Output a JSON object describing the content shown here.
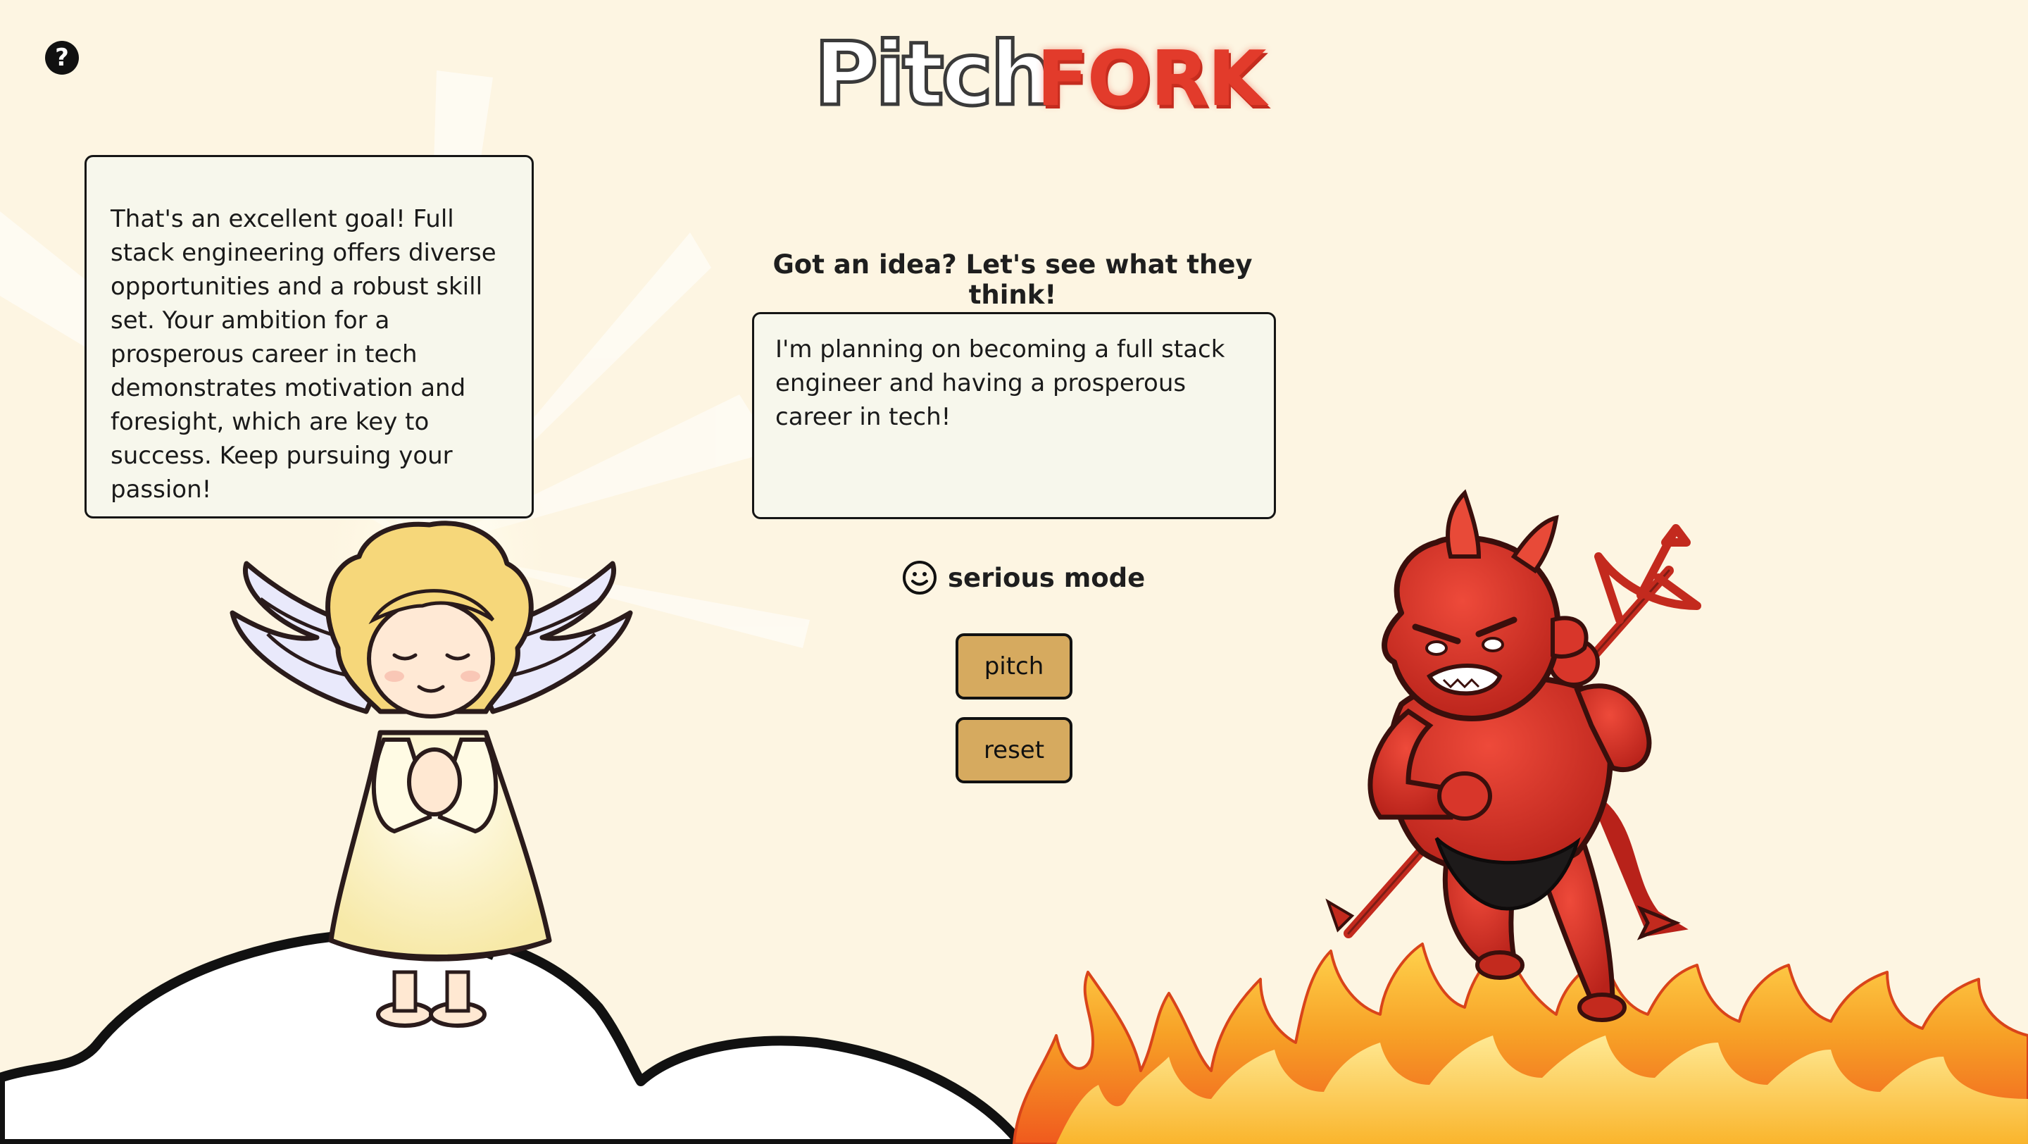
{
  "app": {
    "logo_left": "Pitch",
    "logo_right": "FORK",
    "help_glyph": "?"
  },
  "angel": {
    "response": "That's an excellent goal! Full stack engineering offers diverse opportunities and a robust skill set. Your ambition for a prosperous career in tech demonstrates motivation and foresight, which are key to success. Keep pursuing your passion!"
  },
  "main": {
    "prompt_label": "Got an idea? Let's see what they think!",
    "idea_text": "I'm planning on becoming a full stack engineer and having a prosperous career in tech!",
    "mode_label": "serious mode",
    "mode_icon": "smiley-face-icon",
    "pitch_label": "pitch",
    "reset_label": "reset"
  },
  "colors": {
    "background": "#fdf5e2",
    "panel": "#f7f7ec",
    "button": "#d6aa5f",
    "brand_red": "#e23b2b"
  }
}
